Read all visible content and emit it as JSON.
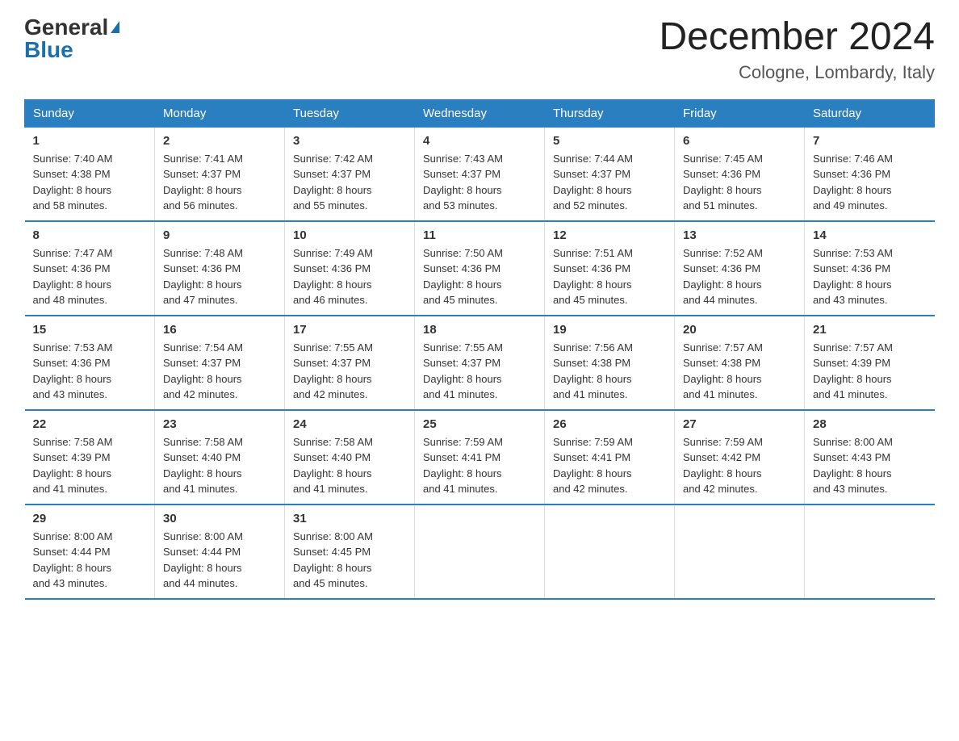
{
  "logo": {
    "general": "General",
    "blue": "Blue",
    "triangle": "▶"
  },
  "header": {
    "month_year": "December 2024",
    "location": "Cologne, Lombardy, Italy"
  },
  "days_of_week": [
    "Sunday",
    "Monday",
    "Tuesday",
    "Wednesday",
    "Thursday",
    "Friday",
    "Saturday"
  ],
  "weeks": [
    [
      {
        "day": "1",
        "sunrise": "7:40 AM",
        "sunset": "4:38 PM",
        "daylight": "8 hours and 58 minutes."
      },
      {
        "day": "2",
        "sunrise": "7:41 AM",
        "sunset": "4:37 PM",
        "daylight": "8 hours and 56 minutes."
      },
      {
        "day": "3",
        "sunrise": "7:42 AM",
        "sunset": "4:37 PM",
        "daylight": "8 hours and 55 minutes."
      },
      {
        "day": "4",
        "sunrise": "7:43 AM",
        "sunset": "4:37 PM",
        "daylight": "8 hours and 53 minutes."
      },
      {
        "day": "5",
        "sunrise": "7:44 AM",
        "sunset": "4:37 PM",
        "daylight": "8 hours and 52 minutes."
      },
      {
        "day": "6",
        "sunrise": "7:45 AM",
        "sunset": "4:36 PM",
        "daylight": "8 hours and 51 minutes."
      },
      {
        "day": "7",
        "sunrise": "7:46 AM",
        "sunset": "4:36 PM",
        "daylight": "8 hours and 49 minutes."
      }
    ],
    [
      {
        "day": "8",
        "sunrise": "7:47 AM",
        "sunset": "4:36 PM",
        "daylight": "8 hours and 48 minutes."
      },
      {
        "day": "9",
        "sunrise": "7:48 AM",
        "sunset": "4:36 PM",
        "daylight": "8 hours and 47 minutes."
      },
      {
        "day": "10",
        "sunrise": "7:49 AM",
        "sunset": "4:36 PM",
        "daylight": "8 hours and 46 minutes."
      },
      {
        "day": "11",
        "sunrise": "7:50 AM",
        "sunset": "4:36 PM",
        "daylight": "8 hours and 45 minutes."
      },
      {
        "day": "12",
        "sunrise": "7:51 AM",
        "sunset": "4:36 PM",
        "daylight": "8 hours and 45 minutes."
      },
      {
        "day": "13",
        "sunrise": "7:52 AM",
        "sunset": "4:36 PM",
        "daylight": "8 hours and 44 minutes."
      },
      {
        "day": "14",
        "sunrise": "7:53 AM",
        "sunset": "4:36 PM",
        "daylight": "8 hours and 43 minutes."
      }
    ],
    [
      {
        "day": "15",
        "sunrise": "7:53 AM",
        "sunset": "4:36 PM",
        "daylight": "8 hours and 43 minutes."
      },
      {
        "day": "16",
        "sunrise": "7:54 AM",
        "sunset": "4:37 PM",
        "daylight": "8 hours and 42 minutes."
      },
      {
        "day": "17",
        "sunrise": "7:55 AM",
        "sunset": "4:37 PM",
        "daylight": "8 hours and 42 minutes."
      },
      {
        "day": "18",
        "sunrise": "7:55 AM",
        "sunset": "4:37 PM",
        "daylight": "8 hours and 41 minutes."
      },
      {
        "day": "19",
        "sunrise": "7:56 AM",
        "sunset": "4:38 PM",
        "daylight": "8 hours and 41 minutes."
      },
      {
        "day": "20",
        "sunrise": "7:57 AM",
        "sunset": "4:38 PM",
        "daylight": "8 hours and 41 minutes."
      },
      {
        "day": "21",
        "sunrise": "7:57 AM",
        "sunset": "4:39 PM",
        "daylight": "8 hours and 41 minutes."
      }
    ],
    [
      {
        "day": "22",
        "sunrise": "7:58 AM",
        "sunset": "4:39 PM",
        "daylight": "8 hours and 41 minutes."
      },
      {
        "day": "23",
        "sunrise": "7:58 AM",
        "sunset": "4:40 PM",
        "daylight": "8 hours and 41 minutes."
      },
      {
        "day": "24",
        "sunrise": "7:58 AM",
        "sunset": "4:40 PM",
        "daylight": "8 hours and 41 minutes."
      },
      {
        "day": "25",
        "sunrise": "7:59 AM",
        "sunset": "4:41 PM",
        "daylight": "8 hours and 41 minutes."
      },
      {
        "day": "26",
        "sunrise": "7:59 AM",
        "sunset": "4:41 PM",
        "daylight": "8 hours and 42 minutes."
      },
      {
        "day": "27",
        "sunrise": "7:59 AM",
        "sunset": "4:42 PM",
        "daylight": "8 hours and 42 minutes."
      },
      {
        "day": "28",
        "sunrise": "8:00 AM",
        "sunset": "4:43 PM",
        "daylight": "8 hours and 43 minutes."
      }
    ],
    [
      {
        "day": "29",
        "sunrise": "8:00 AM",
        "sunset": "4:44 PM",
        "daylight": "8 hours and 43 minutes."
      },
      {
        "day": "30",
        "sunrise": "8:00 AM",
        "sunset": "4:44 PM",
        "daylight": "8 hours and 44 minutes."
      },
      {
        "day": "31",
        "sunrise": "8:00 AM",
        "sunset": "4:45 PM",
        "daylight": "8 hours and 45 minutes."
      },
      null,
      null,
      null,
      null
    ]
  ],
  "labels": {
    "sunrise": "Sunrise: ",
    "sunset": "Sunset: ",
    "daylight": "Daylight: "
  }
}
